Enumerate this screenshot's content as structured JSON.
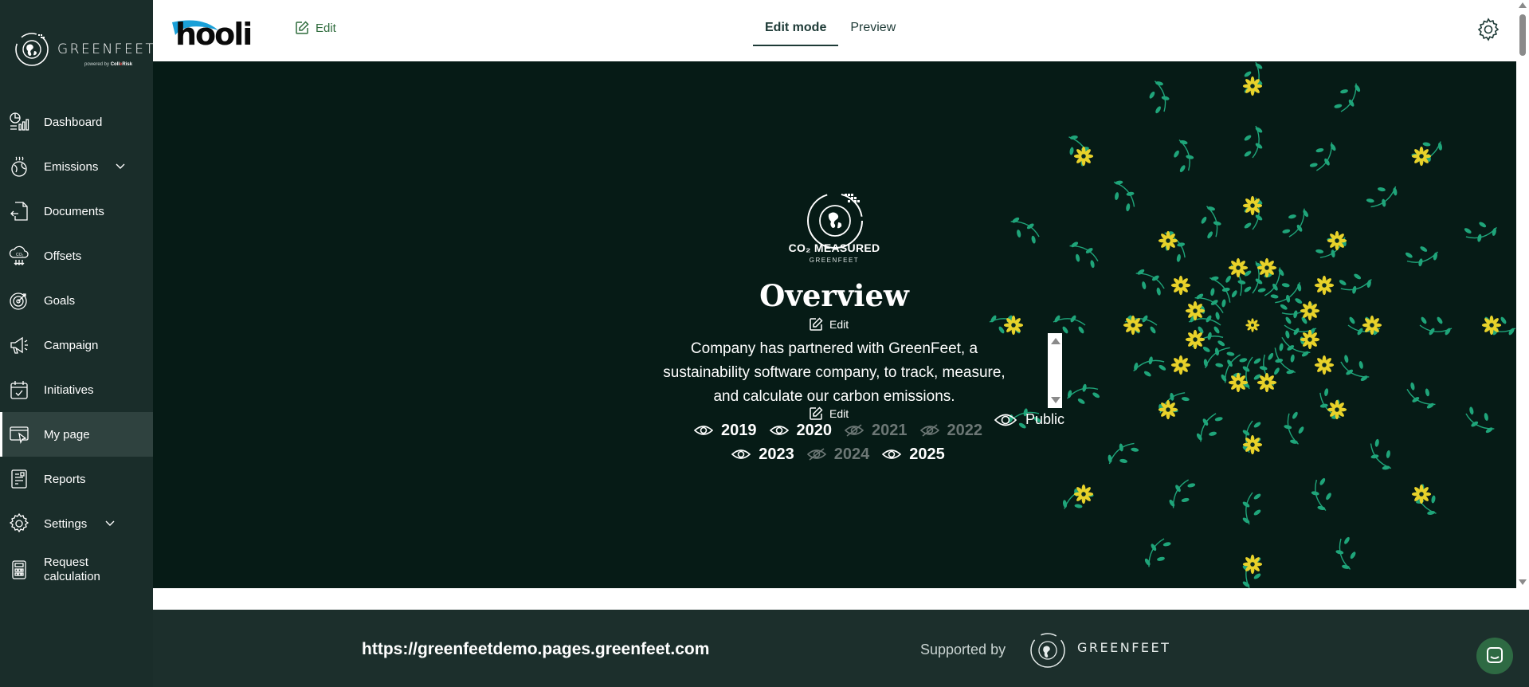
{
  "brand": {
    "name": "GREENFEET",
    "powered_prefix": "powered by ",
    "powered_a": "Coll",
    "powered_mark": "e",
    "powered_b": "Risk"
  },
  "sidebar": {
    "items": [
      {
        "label": "Dashboard",
        "icon": "dashboard-icon"
      },
      {
        "label": "Emissions",
        "icon": "emissions-icon",
        "expandable": true
      },
      {
        "label": "Documents",
        "icon": "documents-icon"
      },
      {
        "label": "Offsets",
        "icon": "offsets-icon"
      },
      {
        "label": "Goals",
        "icon": "goals-icon"
      },
      {
        "label": "Campaign",
        "icon": "campaign-icon"
      },
      {
        "label": "Initiatives",
        "icon": "initiatives-icon"
      },
      {
        "label": "My page",
        "icon": "my-page-icon",
        "active": true
      },
      {
        "label": "Reports",
        "icon": "reports-icon"
      },
      {
        "label": "Settings",
        "icon": "settings-icon",
        "expandable": true
      },
      {
        "label_line1": "Request",
        "label_line2": "calculation",
        "icon": "calculator-icon"
      }
    ]
  },
  "topbar": {
    "logo_text": "hooli",
    "edit_label": "Edit",
    "tabs": [
      {
        "label": "Edit mode",
        "active": true
      },
      {
        "label": "Preview",
        "active": false
      }
    ]
  },
  "hero": {
    "badge_title": "CO₂ MEASURED",
    "badge_sub": "GREENFEET",
    "title": "Overview",
    "edit_title_label": "Edit",
    "description_lines": [
      "Company has partnered with GreenFeet, a",
      "sustainability software company, to track, measure,",
      "and calculate our carbon emissions."
    ],
    "edit_desc_label": "Edit",
    "public_label": "Public",
    "years_row1": [
      {
        "year": "2019",
        "visible": true
      },
      {
        "year": "2020",
        "visible": true
      },
      {
        "year": "2021",
        "visible": false
      },
      {
        "year": "2022",
        "visible": false
      }
    ],
    "years_row2": [
      {
        "year": "2023",
        "visible": true
      },
      {
        "year": "2024",
        "visible": false
      },
      {
        "year": "2025",
        "visible": true
      }
    ]
  },
  "footer": {
    "url": "https://greenfeetdemo.pages.greenfeet.com",
    "supported_by": "Supported by",
    "brand_name": "GREENFEET"
  },
  "colors": {
    "sidebar_bg": "#1a2d2a",
    "hero_bg": "#061b16",
    "accent_green": "#2e6b3c",
    "leaf": "#1fa57a",
    "flower": "#e8d22a"
  }
}
